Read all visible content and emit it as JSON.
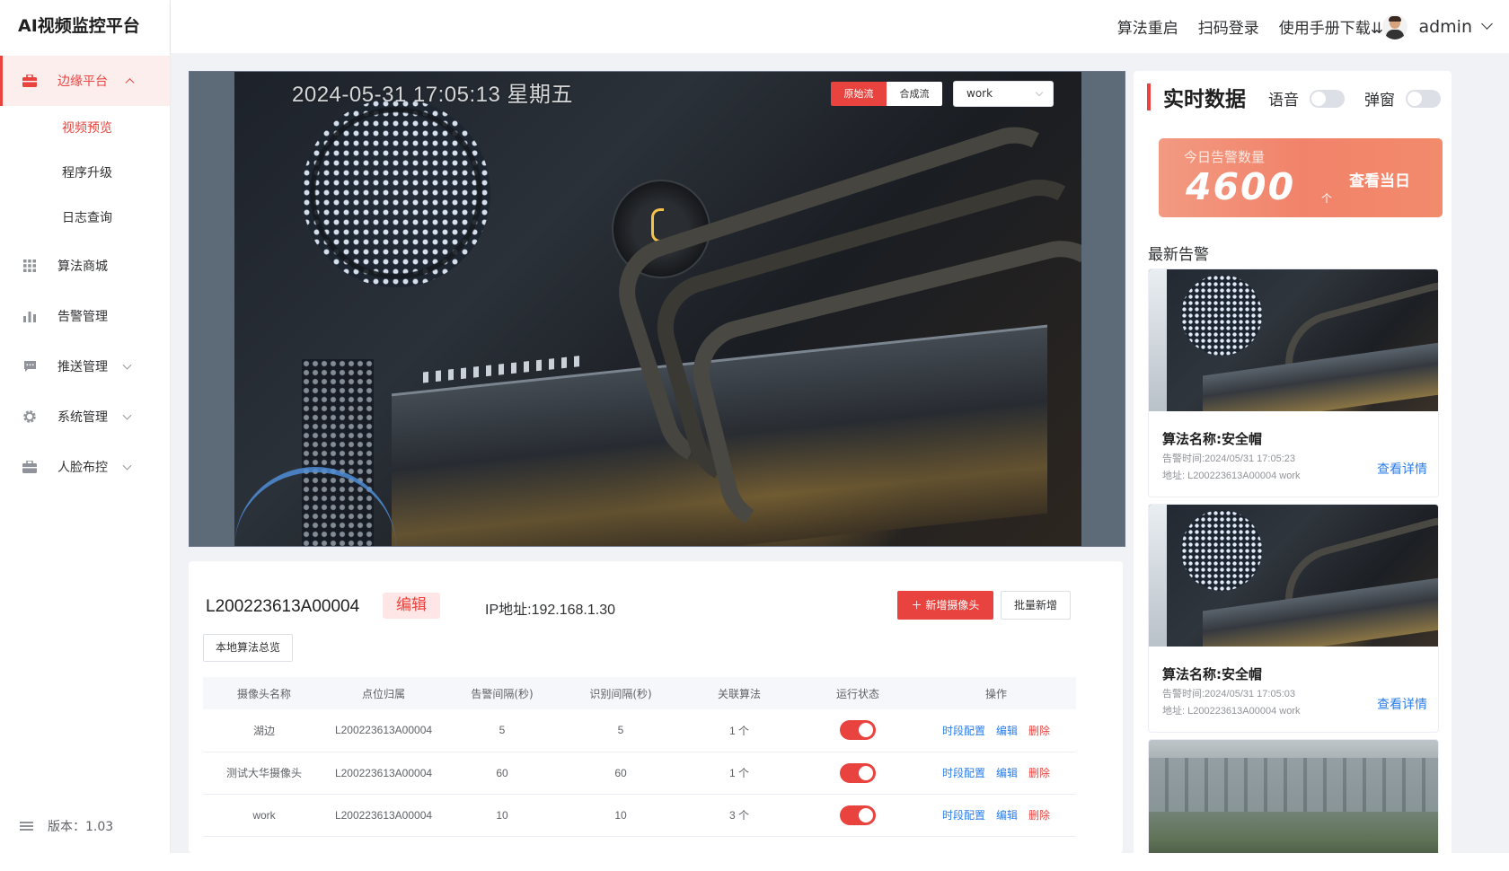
{
  "app": {
    "title": "AI视频监控平台"
  },
  "sidebar": {
    "menu": [
      {
        "label": "边缘平台",
        "icon": "briefcase-icon",
        "expanded": true
      },
      {
        "label": "算法商城",
        "icon": "grid-icon"
      },
      {
        "label": "告警管理",
        "icon": "bar-chart-icon"
      },
      {
        "label": "推送管理",
        "icon": "message-icon"
      },
      {
        "label": "系统管理",
        "icon": "gear-icon"
      },
      {
        "label": "人脸布控",
        "icon": "briefcase-icon"
      }
    ],
    "submenu": [
      "视频预览",
      "程序升级",
      "日志查询"
    ],
    "version": "版本：1.03"
  },
  "topbar": {
    "links": [
      "算法重启",
      "扫码登录",
      "使用手册下载⇊"
    ],
    "username": "admin"
  },
  "video": {
    "timestamp": "2024-05-31 17:05:13 星期五",
    "stream_tabs": [
      "原始流",
      "合成流"
    ],
    "active_stream": "原始流",
    "camera_select": "work"
  },
  "device": {
    "id": "L200223613A00004",
    "edit_label": "编辑",
    "ip": "IP地址:192.168.1.30",
    "add_camera_label": "新增摄像头",
    "batch_add_label": "批量新增",
    "local_algo_label": "本地算法总览",
    "table": {
      "headers": [
        "摄像头名称",
        "点位归属",
        "告警间隔(秒)",
        "识别间隔(秒)",
        "关联算法",
        "运行状态",
        "操作"
      ],
      "rows": [
        {
          "name": "湖边",
          "location": "L200223613A00004",
          "alarm_interval": "5",
          "detect_interval": "5",
          "algorithms": "1 个",
          "running": true
        },
        {
          "name": "测试大华摄像头",
          "location": "L200223613A00004",
          "alarm_interval": "60",
          "detect_interval": "60",
          "algorithms": "1 个",
          "running": true
        },
        {
          "name": "work",
          "location": "L200223613A00004",
          "alarm_interval": "10",
          "detect_interval": "10",
          "algorithms": "3 个",
          "running": true
        }
      ],
      "ops": [
        "时段配置",
        "编辑",
        "删除"
      ]
    }
  },
  "realtime": {
    "title": "实时数据",
    "voice_label": "语音",
    "popup_label": "弹窗",
    "today_alarm_label": "今日告警数量",
    "today_alarm_count": "4600",
    "today_alarm_unit": "个",
    "view_today_label": "查看当日",
    "latest_title": "最新告警",
    "alarms": [
      {
        "name": "算法名称:安全帽",
        "time": "告警时间:2024/05/31 17:05:23",
        "addr": "地址: L200223613A00004 work",
        "detail": "查看详情"
      },
      {
        "name": "算法名称:安全帽",
        "time": "告警时间:2024/05/31 17:05:03",
        "addr": "地址: L200223613A00004 work",
        "detail": "查看详情"
      }
    ]
  },
  "colors": {
    "accent": "#e8433e",
    "link": "#2b7de9"
  }
}
